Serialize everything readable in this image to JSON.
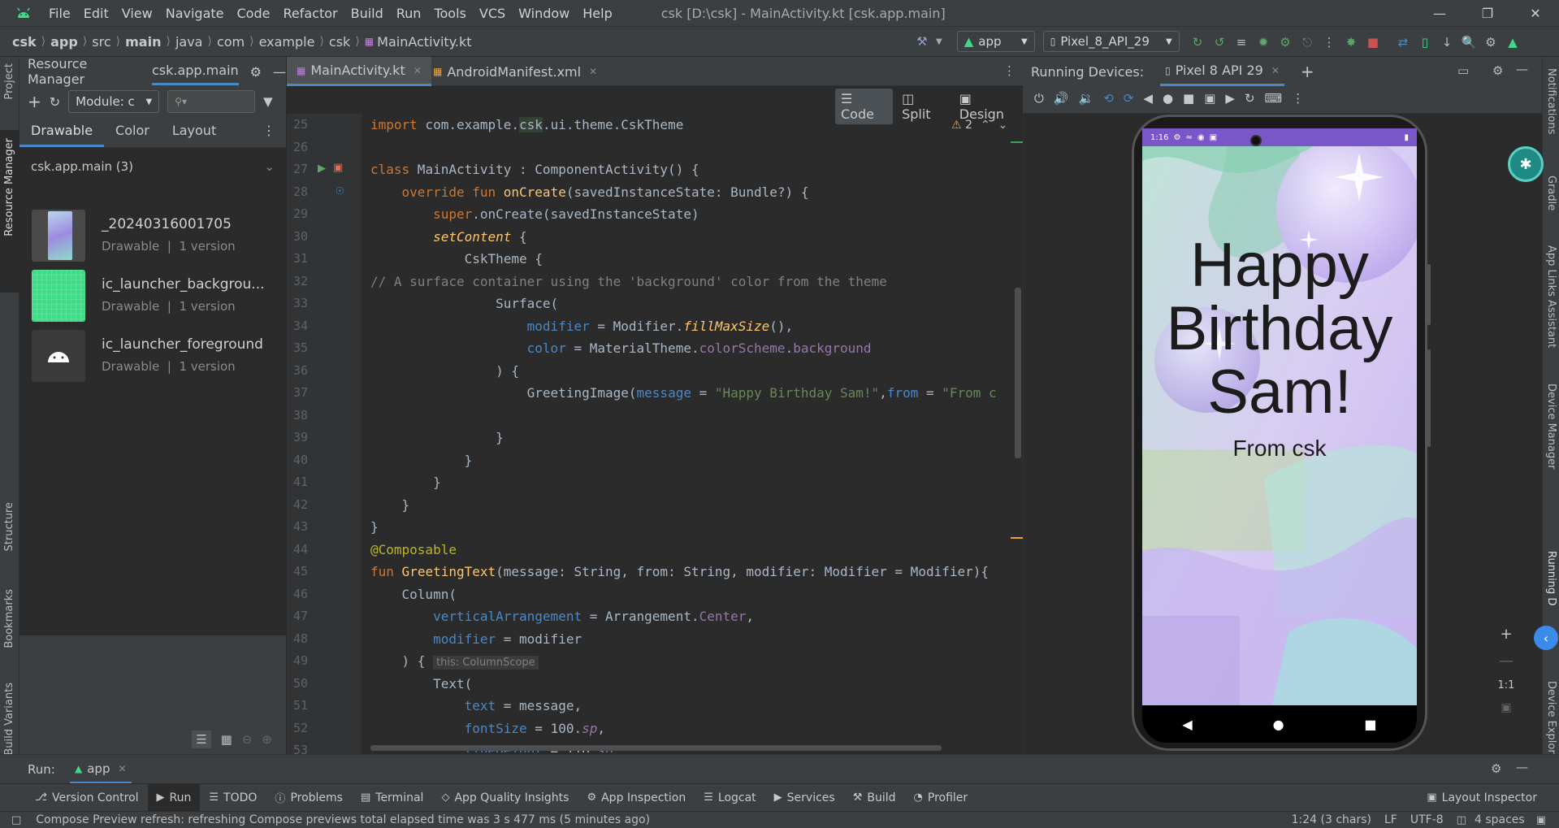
{
  "window": {
    "title": "csk [D:\\csk] - MainActivity.kt [csk.app.main]",
    "menu": [
      "File",
      "Edit",
      "View",
      "Navigate",
      "Code",
      "Refactor",
      "Build",
      "Run",
      "Tools",
      "VCS",
      "Window",
      "Help"
    ]
  },
  "breadcrumb": [
    "csk",
    "app",
    "src",
    "main",
    "java",
    "com",
    "example",
    "csk",
    "MainActivity.kt"
  ],
  "toolbar": {
    "run_config": "app",
    "device": "Pixel_8_API_29"
  },
  "left_stripe": {
    "project": "Project",
    "resource_manager": "Resource Manager",
    "structure": "Structure",
    "bookmarks": "Bookmarks",
    "build_variants": "Build Variants"
  },
  "resource_manager": {
    "title": "Resource Manager",
    "module_tab": "csk.app.main",
    "module_select": "Module: c",
    "tabs": [
      "Drawable",
      "Color",
      "Layout"
    ],
    "group": "csk.app.main (3)",
    "items": [
      {
        "name": "_20240316001705",
        "type": "Drawable",
        "version": "1 version"
      },
      {
        "name": "ic_launcher_backgrou...",
        "type": "Drawable",
        "version": "1 version"
      },
      {
        "name": "ic_launcher_foreground",
        "type": "Drawable",
        "version": "1 version"
      }
    ]
  },
  "editor": {
    "tabs": [
      "MainActivity.kt",
      "AndroidManifest.xml"
    ],
    "views": [
      "Code",
      "Split",
      "Design"
    ],
    "warnings": "2",
    "hint": "this: ColumnScope",
    "line_numbers": [
      "25",
      "26",
      "27",
      "28",
      "29",
      "30",
      "31",
      "32",
      "33",
      "34",
      "35",
      "36",
      "37",
      "38",
      "39",
      "40",
      "41",
      "42",
      "43",
      "44",
      "45",
      "46",
      "47",
      "48",
      "49",
      "50",
      "51",
      "52",
      "53"
    ]
  },
  "devices": {
    "label": "Running Devices:",
    "tab": "Pixel 8 API 29",
    "status_time": "1:16",
    "greeting": "Happy Birthday Sam!",
    "from": "From csk",
    "zoom": "1:1"
  },
  "right_stripe": {
    "notifications": "Notifications",
    "gradle": "Gradle",
    "app_links": "App Links Assistant",
    "device_manager": "Device Manager",
    "running_devices": "Running D",
    "device_explorer": "Device Explorer"
  },
  "run": {
    "label": "Run:",
    "config": "app"
  },
  "tool_windows": [
    "Version Control",
    "Run",
    "TODO",
    "Problems",
    "Terminal",
    "App Quality Insights",
    "App Inspection",
    "Logcat",
    "Services",
    "Build",
    "Profiler",
    "Layout Inspector"
  ],
  "status": {
    "message": "Compose Preview refresh: refreshing Compose previews total elapsed time was 3 s 477 ms (5 minutes ago)",
    "position": "1:24 (3 chars)",
    "line_sep": "LF",
    "encoding": "UTF-8",
    "indent": "4 spaces"
  },
  "colors": {
    "ide_bg": "#2b2b2b",
    "panel_bg": "#3c3f41",
    "accent": "#4a88c7",
    "android_green": "#3ddc84"
  }
}
